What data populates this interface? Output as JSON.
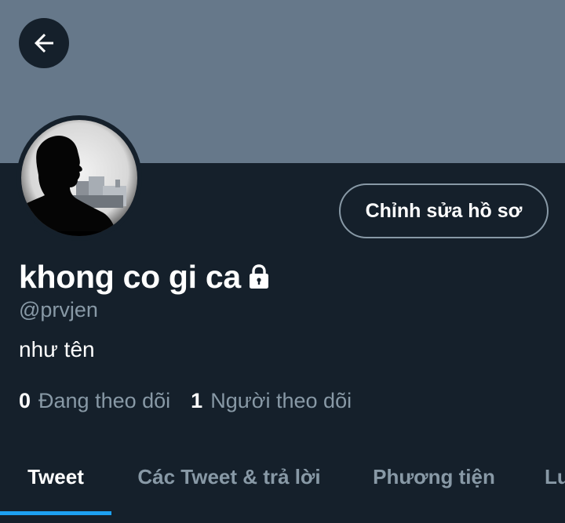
{
  "profile": {
    "display_name": "khong co gi ca",
    "handle": "@prvjen",
    "bio": "như tên",
    "locked": true
  },
  "header": {
    "back_icon": "arrow-left-icon"
  },
  "actions": {
    "edit_profile_label": "Chỉnh sửa hồ sơ"
  },
  "stats": {
    "following_count": "0",
    "following_label": "Đang theo dõi",
    "followers_count": "1",
    "followers_label": "Người theo dõi"
  },
  "tabs": [
    {
      "label": "Tweet",
      "active": true
    },
    {
      "label": "Các Tweet & trả lời",
      "active": false
    },
    {
      "label": "Phương tiện",
      "active": false
    },
    {
      "label": "Lư",
      "active": false
    }
  ],
  "colors": {
    "background": "#15202b",
    "banner": "#66788a",
    "secondary_text": "#8899a6",
    "accent": "#1da1f2"
  }
}
